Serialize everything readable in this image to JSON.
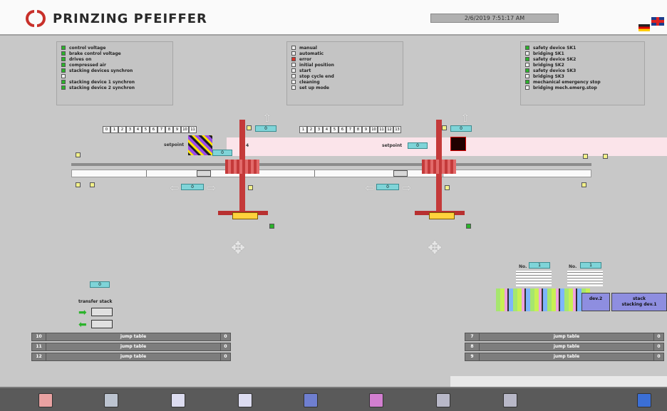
{
  "header": {
    "logo_text": "PRINZING PFEIFFER",
    "datetime": "2/6/2019 7:51:17 AM"
  },
  "panels": {
    "left": [
      {
        "label": "control voltage",
        "state": "green"
      },
      {
        "label": "brake control voltage",
        "state": "green"
      },
      {
        "label": "drives on",
        "state": "green"
      },
      {
        "label": "compressed air",
        "state": "green"
      },
      {
        "label": "stacking devices synchron",
        "state": "green"
      },
      {
        "label": "",
        "state": "white"
      },
      {
        "label": "stacking device 1 synchron",
        "state": "green"
      },
      {
        "label": "stacking device 2 synchron",
        "state": "green"
      }
    ],
    "middle": [
      {
        "label": "manual",
        "state": "white"
      },
      {
        "label": "automatic",
        "state": "white"
      },
      {
        "label": "error",
        "state": "red"
      },
      {
        "label": "initial position",
        "state": "white"
      },
      {
        "label": "start",
        "state": "white"
      },
      {
        "label": "stop cycle end",
        "state": "white"
      },
      {
        "label": "cleaning",
        "state": "white"
      },
      {
        "label": "set up mode",
        "state": "white"
      }
    ],
    "right": [
      {
        "label": "safety device SK1",
        "state": "green"
      },
      {
        "label": "bridging SK1",
        "state": "white"
      },
      {
        "label": "safety device SK2",
        "state": "green"
      },
      {
        "label": "bridging SK2",
        "state": "white"
      },
      {
        "label": "safety device SK3",
        "state": "green"
      },
      {
        "label": "bridging SK3",
        "state": "white"
      },
      {
        "label": "mechanical emergency stop",
        "state": "green"
      },
      {
        "label": "bridging mech.emerg.stop",
        "state": "white"
      }
    ]
  },
  "process": {
    "counter_left": [
      "0",
      "1",
      "2",
      "3",
      "4",
      "5",
      "6",
      "7",
      "8",
      "9",
      "10",
      "11"
    ],
    "counter_right": [
      "1",
      "2",
      "3",
      "4",
      "5",
      "6",
      "7",
      "8",
      "9",
      "10",
      "11",
      "12",
      "13"
    ],
    "setpoint_label": "setpoint",
    "left_top_value": "0",
    "right_top_value": "0",
    "left_setpoint_value": "0",
    "right_setpoint_value": "0",
    "left_mid_value": "0",
    "right_mid_value": "0",
    "left_marker": "4",
    "transfer_value": "0"
  },
  "transfer": {
    "label": "transfer stack"
  },
  "stacks": {
    "no_label": "No.",
    "no1_value": "1",
    "no2_value": "1",
    "stack_label_1": "dev.2",
    "stack_label_2": "stack\nstacking dev.1"
  },
  "jump_left": [
    {
      "num": "10",
      "label": "jump table",
      "arrow": "0"
    },
    {
      "num": "11",
      "label": "jump table",
      "arrow": "0"
    },
    {
      "num": "12",
      "label": "jump table",
      "arrow": "0"
    }
  ],
  "jump_right": [
    {
      "num": "7",
      "label": "jump table",
      "arrow": "0"
    },
    {
      "num": "8",
      "label": "jump table",
      "arrow": "0"
    },
    {
      "num": "9",
      "label": "jump table",
      "arrow": "0"
    }
  ],
  "toolbar": {
    "buttons": [
      "book-icon",
      "clipboard-icon",
      "chart-icon",
      "machine-icon",
      "joystick-icon",
      "display-icon",
      "tool-icon",
      "settings-icon",
      "folder-icon"
    ]
  },
  "colors": {
    "green": "#2bb32b",
    "red": "#d8342a",
    "crane_red": "#c43a3a",
    "cyan": "#7fd4d8",
    "pink_band": "#fbe4ea"
  }
}
